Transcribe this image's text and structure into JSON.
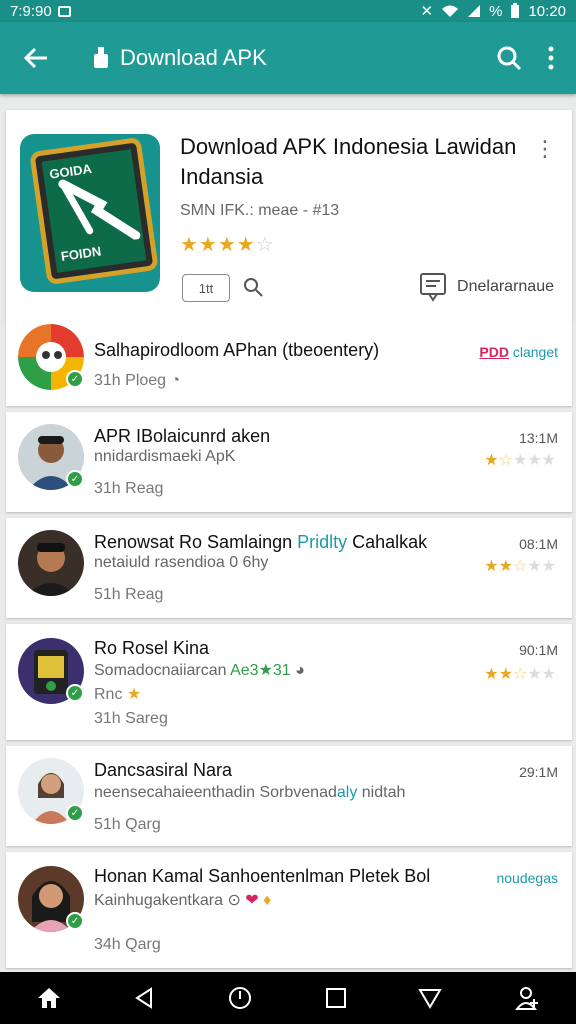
{
  "status": {
    "time_left": "7:9:90",
    "battery": "%",
    "time_right": "10:20"
  },
  "appbar": {
    "title": "Download APK"
  },
  "hero": {
    "title": "Download APK Indonesia Lawidan Indansia",
    "meta": "SMN IFK.: meae - #13",
    "stars": 4,
    "chip": "1tt",
    "download_label": "Dnelararnaue",
    "icon_text_top": "GOIDA",
    "icon_text_bottom": "FOIDN"
  },
  "items": [
    {
      "title": "Salhapirodloom APhan (tbeoentery)",
      "subtitle": "",
      "age": "31h Ploeg",
      "tag1": "PDD",
      "tag2": "clanget",
      "time": "",
      "stars": 0
    },
    {
      "title": "APR IBolaicunrd aken",
      "subtitle": "nnidardismaeki ApK",
      "age": "31h Reag",
      "time": "13:1M",
      "stars": 1.5
    },
    {
      "title_a": "Renowsat Ro Samlaingn ",
      "title_b": "Pridlty",
      "title_c": " Cahalkak",
      "subtitle": "netaiuld rasendioa 0 6hy",
      "age": "51h Reag",
      "time": "08:1M",
      "stars": 2.5
    },
    {
      "title": "Ro Rosel Kina",
      "subtitle_a": "Somadocnaiiarcan ",
      "subtitle_b": "Ae3★31",
      "age_a": "Rnc",
      "age": "31h Sareg",
      "time": "90:1M",
      "stars": 2.5
    },
    {
      "title": "Dancsasiral Nara",
      "subtitle_a": "neensecahaieenthadin Sorbvenad",
      "subtitle_b": "aly",
      "subtitle_c": " nidtah",
      "age": "51h Qarg",
      "time": "29:1M",
      "stars": 0
    },
    {
      "title": "Honan Kamal Sanhoentenlman Pletek Bol",
      "subtitle": "Kainhugakentkara",
      "age": "34h Qarg",
      "time": "noudegas",
      "stars": 0
    }
  ]
}
